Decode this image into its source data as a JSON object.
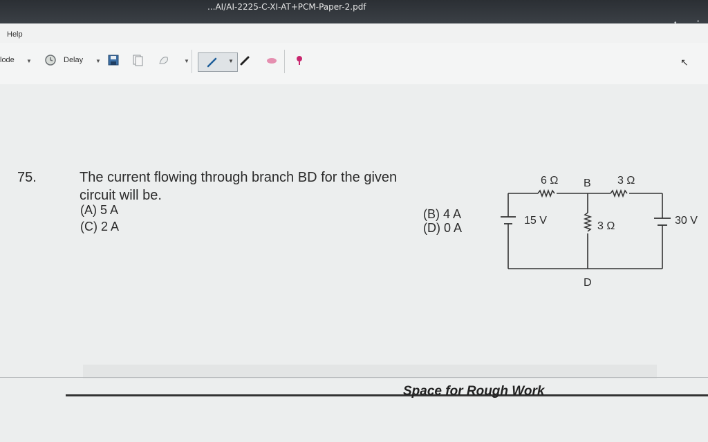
{
  "window": {
    "title": "...AI/AI-2225-C-XI-AT+PCM-Paper-2.pdf"
  },
  "menubar": {
    "help": "Help"
  },
  "toolbar": {
    "mode_label": "lode",
    "delay_label": "Delay"
  },
  "question": {
    "number": "75.",
    "line1": "The current flowing through branch BD for the given",
    "line2": "circuit will be.",
    "options": {
      "a": "(A) 5 A",
      "b": "(B) 4 A",
      "c": "(C) 2 A",
      "d": "(D) 0 A"
    }
  },
  "circuit": {
    "r_left": "6 Ω",
    "node_b": "B",
    "r_right": "3 Ω",
    "v_left": "15 V",
    "r_mid": "3 Ω",
    "v_right": "30 V",
    "node_d": "D"
  },
  "footer": {
    "rough_work": "Space for Rough Work"
  },
  "icons": [
    "save-icon",
    "copy-icon",
    "shape-icon",
    "pen-icon",
    "marker-icon",
    "eraser-icon",
    "pin-icon",
    "clock-icon",
    "cursor-icon"
  ]
}
